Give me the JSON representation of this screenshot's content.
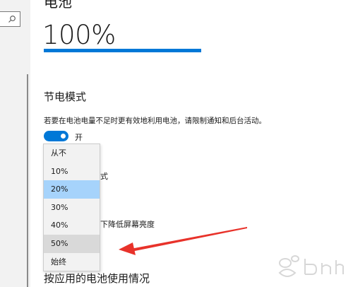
{
  "header": {
    "partial_title": "电池"
  },
  "battery": {
    "percent_text": "100%",
    "level": 1.0
  },
  "saver": {
    "title": "节电模式",
    "description": "若要在电池电量不足时更有效地利用电池，请限制通知和后台活动。",
    "toggle_label": "开",
    "toggle_on": true,
    "hidden_text_1": "式",
    "hidden_text_2": "下降低屏幕亮度"
  },
  "dropdown": {
    "options": [
      "从不",
      "10%",
      "20%",
      "30%",
      "40%",
      "50%",
      "始终"
    ],
    "selected": "20%",
    "highlighted": "50%"
  },
  "usage": {
    "title": "按应用的电池使用情况"
  },
  "colors": {
    "accent": "#0078d7",
    "selected": "#a6d3fb",
    "arrow": "#e8322a"
  },
  "icons": {
    "search": "search-icon",
    "arrow": "red-arrow-annotation"
  }
}
